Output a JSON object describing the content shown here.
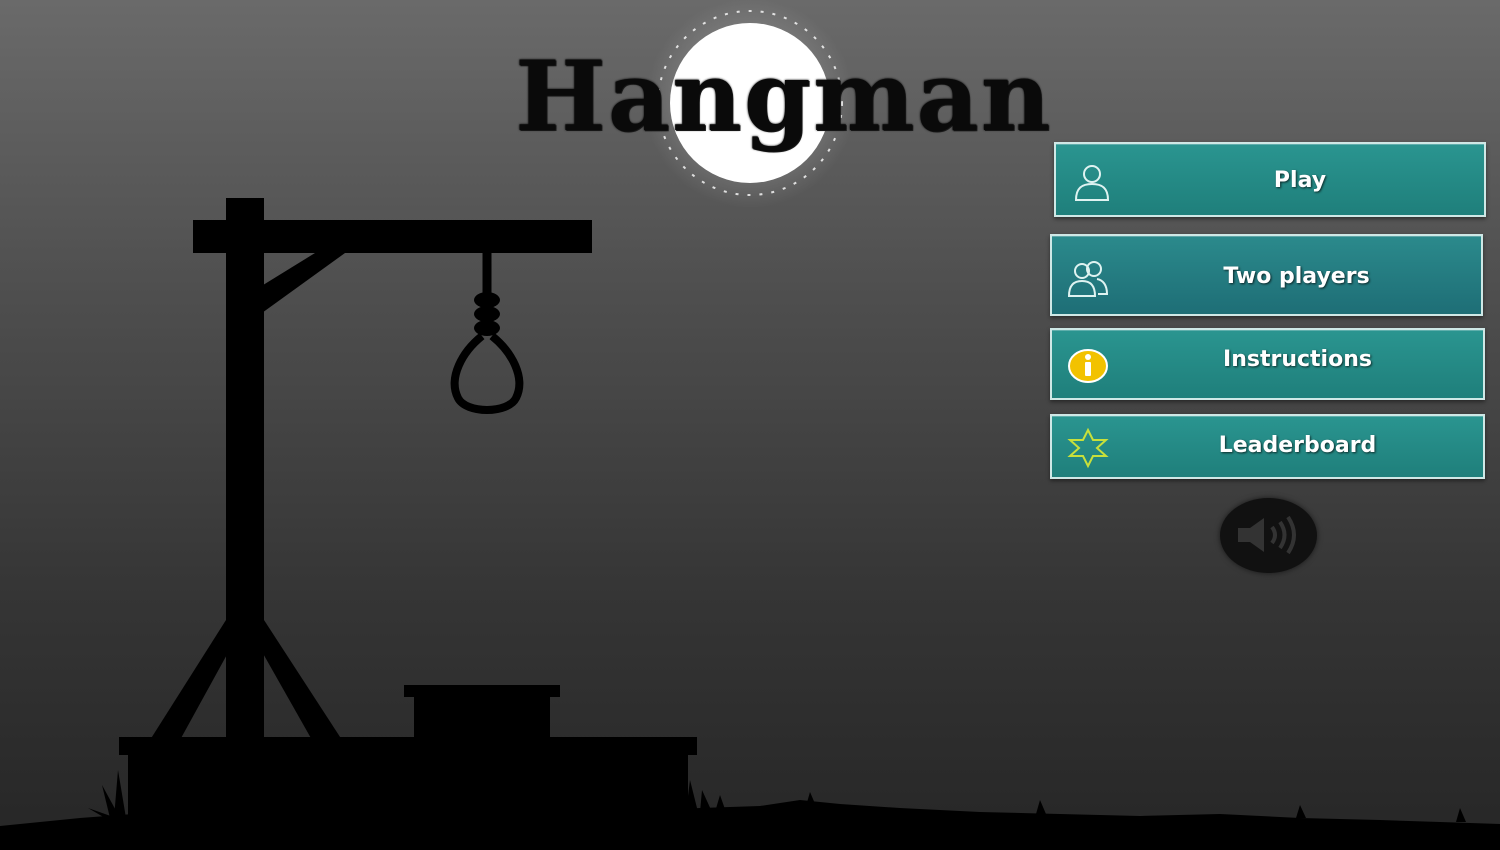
{
  "game": {
    "title": "Hangman"
  },
  "menu": {
    "play_label": "Play",
    "two_players_label": "Two players",
    "instructions_label": "Instructions",
    "leaderboard_label": "Leaderboard"
  },
  "icons": {
    "play": "single-user-icon",
    "two_players": "two-users-icon",
    "instructions": "info-icon",
    "leaderboard": "star-icon",
    "sound": "speaker-icon",
    "moon": "moon-icon"
  },
  "colors": {
    "button": "#1f7f7b",
    "button_border": "#cfe8e6",
    "moon": "#ffffff",
    "info_icon": "#f2c200",
    "star_outline": "#c8e03a",
    "silhouette": "#000000"
  }
}
